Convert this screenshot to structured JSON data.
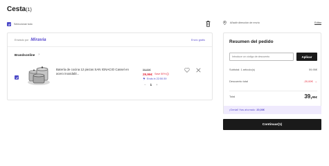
{
  "page": {
    "title": "Cesta",
    "count": "(1)"
  },
  "cart": {
    "select_all_label": "Seleccionar todo",
    "sent_by_label": "Enviado por",
    "marketplace_name": "Miravia",
    "shipping_label": "Envío gratis",
    "store_name": "Brandsonline",
    "item": {
      "name": "Batería de cocina 12 piezas SAN IGNACIO Cassel en acero inoxidabl...",
      "original_price": "59,95€",
      "price": "29,96€",
      "savings": "Save 50%",
      "ends_label": "Ends in 22:50:39",
      "quantity": "1",
      "minus": "−",
      "plus": "+"
    }
  },
  "summary": {
    "address_label": "Añadir dirección de envío",
    "edit_label": "Editar",
    "title": "Resumen del pedido",
    "coupon_placeholder": "Introduce un código de descuento",
    "apply_label": "Aplicar",
    "subtotal_label": "Subtotal: 1 artículo(s)",
    "subtotal_value": "59,95€",
    "discount_label": "Descuento total",
    "discount_value": "-20,00€",
    "total_label": "Total",
    "total_value": "39,",
    "total_decimals": "95€",
    "saved_label": "¡Genial! Has ahorrado",
    "saved_value": "20,00€",
    "continue_label": "Continuar(1)"
  },
  "colors": {
    "accent": "#4b49c7",
    "sale": "#e5283a",
    "dark": "#1a1a1a"
  }
}
